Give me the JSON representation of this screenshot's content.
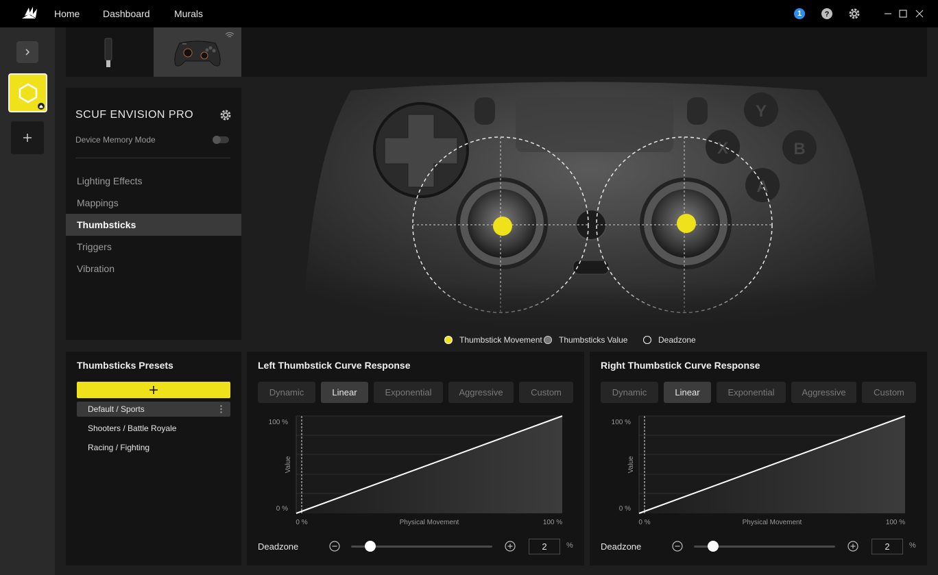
{
  "topbar": {
    "nav": [
      "Home",
      "Dashboard",
      "Murals"
    ],
    "notification_count": "1",
    "icons": [
      "corsair-logo-icon",
      "help-icon",
      "settings-icon",
      "minimize-icon",
      "maximize-icon",
      "close-icon"
    ]
  },
  "colors": {
    "accent": "#efe21a",
    "background": "#1e1e1e",
    "panel": "#141414",
    "selected": "#3a3a3a"
  },
  "device": {
    "name": "SCUF ENVISION PRO",
    "memory_mode_label": "Device Memory Mode",
    "memory_mode_on": false
  },
  "menu": {
    "items": [
      "Lighting Effects",
      "Mappings",
      "Thumbsticks",
      "Triggers",
      "Vibration"
    ],
    "active": "Thumbsticks"
  },
  "controller_legend": [
    "Thumbstick Movement",
    "Thumbsticks Value",
    "Deadzone"
  ],
  "presets": {
    "title": "Thumbsticks Presets",
    "add_label": "+",
    "items": [
      "Default / Sports",
      "Shooters / Battle Royale",
      "Racing / Fighting"
    ],
    "active": "Default / Sports"
  },
  "curves": [
    {
      "title": "Left Thumbstick Curve Response",
      "buttons": [
        "Dynamic",
        "Linear",
        "Exponential",
        "Aggressive",
        "Custom"
      ],
      "active": "Linear",
      "ytick_max": "100 %",
      "ytick_min": "0 %",
      "xtick_min": "0 %",
      "xtick_max": "100 %",
      "xlabel": "Physical Movement",
      "ylabel": "Value",
      "deadzone_label": "Deadzone",
      "deadzone_value": "2",
      "deadzone_unit": "%"
    },
    {
      "title": "Right Thumbstick Curve Response",
      "buttons": [
        "Dynamic",
        "Linear",
        "Exponential",
        "Aggressive",
        "Custom"
      ],
      "active": "Linear",
      "ytick_max": "100 %",
      "ytick_min": "0 %",
      "xtick_min": "0 %",
      "xtick_max": "100 %",
      "xlabel": "Physical Movement",
      "ylabel": "Value",
      "deadzone_label": "Deadzone",
      "deadzone_value": "2",
      "deadzone_unit": "%"
    }
  ]
}
